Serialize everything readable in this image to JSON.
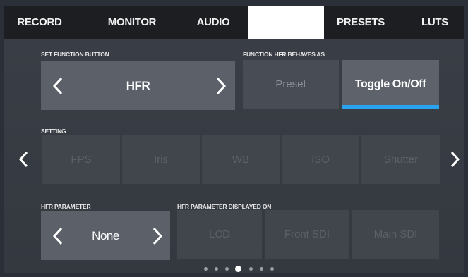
{
  "tabs": [
    {
      "label": "RECORD"
    },
    {
      "label": "MONITOR"
    },
    {
      "label": "AUDIO"
    },
    {
      "label": ""
    },
    {
      "label": "PRESETS"
    },
    {
      "label": "LUTS"
    }
  ],
  "active_tab_index": 3,
  "function_button": {
    "label": "SET FUNCTION BUTTON",
    "value": "HFR"
  },
  "hfr_behaviour": {
    "label": "FUNCTION HFR BEHAVES AS",
    "options": [
      "Preset",
      "Toggle On/Off"
    ],
    "selected": "Toggle On/Off"
  },
  "setting": {
    "label": "SETTING",
    "options": [
      "FPS",
      "Iris",
      "WB",
      "ISO",
      "Shutter"
    ]
  },
  "hfr_parameter": {
    "label": "HFR PARAMETER",
    "value": "None"
  },
  "hfr_displayed_on": {
    "label": "HFR PARAMETER DISPLAYED ON",
    "options": [
      "LCD",
      "Front SDI",
      "Main SDI"
    ]
  },
  "pagination": {
    "total": 7,
    "current": 4
  },
  "colors": {
    "accent": "#29a3f0",
    "tab_bar": "#1c1e22",
    "active_tab": "#ffffff"
  },
  "icons": {
    "prev": "chevron-left-icon",
    "next": "chevron-right-icon"
  }
}
